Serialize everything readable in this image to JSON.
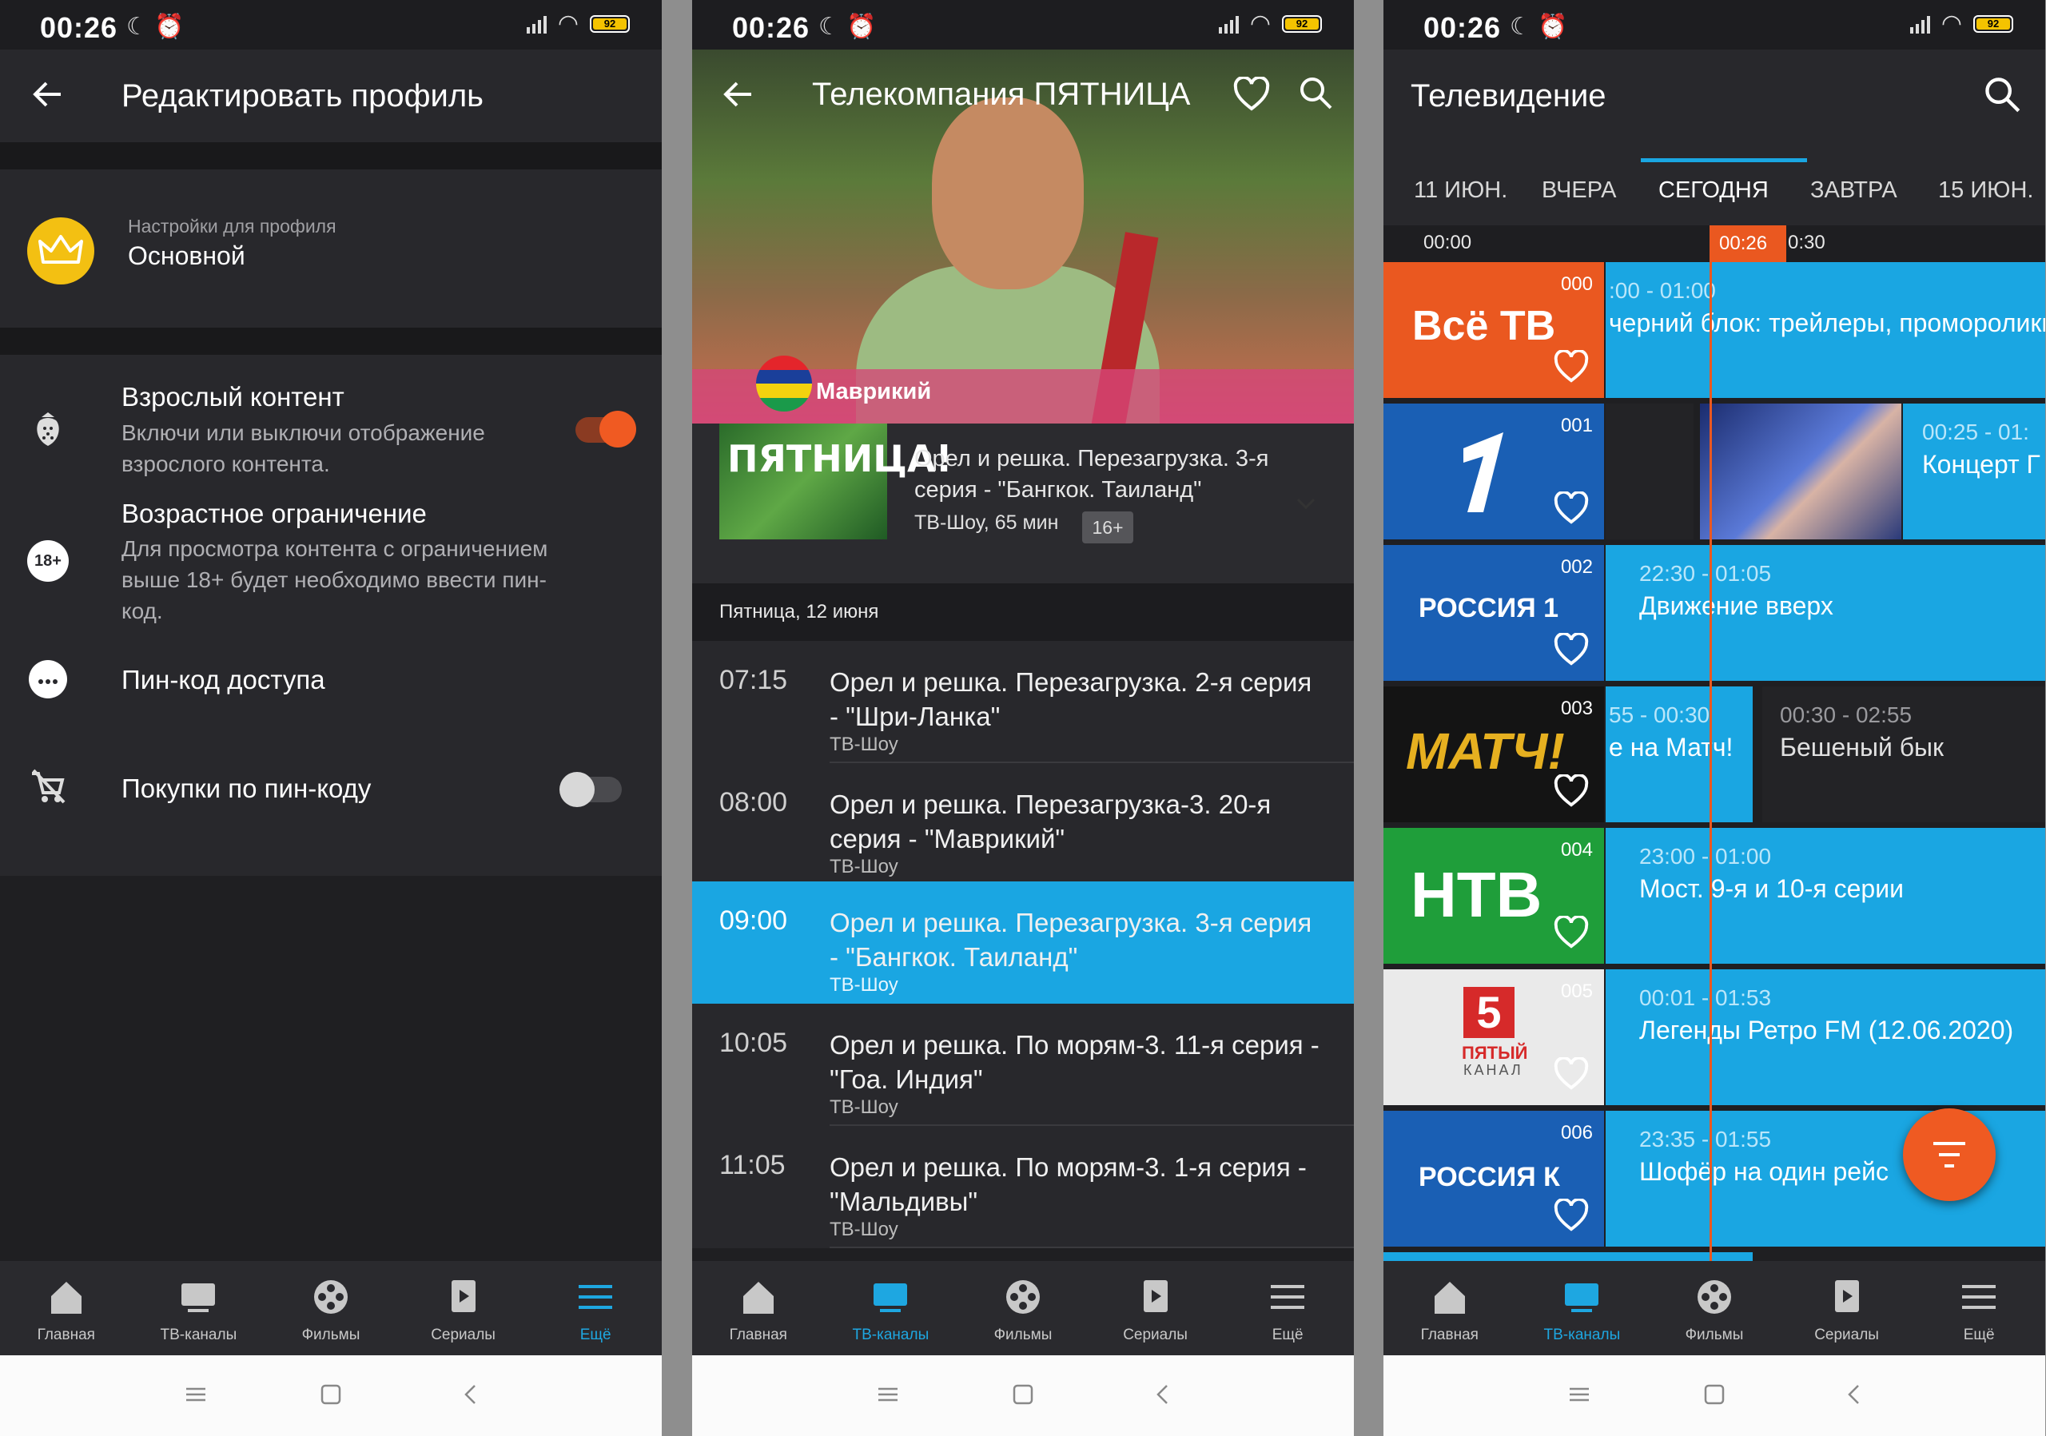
{
  "status": {
    "time": "00:26",
    "battery": "92"
  },
  "nav": {
    "items": [
      {
        "label": "Главная",
        "icon": "home-icon"
      },
      {
        "label": "ТВ-каналы",
        "icon": "tv-icon"
      },
      {
        "label": "Фильмы",
        "icon": "film-reel-icon"
      },
      {
        "label": "Сериалы",
        "icon": "series-icon"
      },
      {
        "label": "Ещё",
        "icon": "menu-icon"
      }
    ]
  },
  "profile_screen": {
    "title": "Редактировать профиль",
    "profile_subtitle": "Настройки для профиля",
    "profile_name": "Основной",
    "settings": [
      {
        "title": "Взрослый контент",
        "desc": "Включи или выключи отображение взрослого контента.",
        "toggle": true,
        "icon": "strawberry-icon"
      },
      {
        "title": "Возрастное ограничение",
        "desc": "Для просмотра контента с ограничением выше 18+ будет необходимо ввести пин-код.",
        "icon": "age-18-icon",
        "icon_text": "18+"
      },
      {
        "title": "Пин-код доступа",
        "icon": "pin-code-icon"
      },
      {
        "title": "Покупки по пин-коду",
        "toggle": false,
        "icon": "no-cart-icon"
      }
    ]
  },
  "channel_screen": {
    "title": "Телекомпания ПЯТНИЦА",
    "hero_caption": "Маврикий",
    "logo_text": "ПЯТНИЦА!",
    "now": {
      "title": "Орел и решка. Перезагрузка. 3-я серия - \"Бангкок. Таиланд\"",
      "meta": "ТВ-Шоу, 65 мин",
      "rating": "16+"
    },
    "date_header": "Пятница, 12 июня",
    "schedule": [
      {
        "time": "07:15",
        "title": "Орел и решка. Перезагрузка. 2-я серия - \"Шри-Ланка\"",
        "genre": "ТВ-Шоу",
        "active": false
      },
      {
        "time": "08:00",
        "title": "Орел и решка. Перезагрузка-3. 20-я серия - \"Маврикий\"",
        "genre": "ТВ-Шоу",
        "active": false
      },
      {
        "time": "09:00",
        "title": "Орел и решка. Перезагрузка. 3-я серия - \"Бангкок. Таиланд\"",
        "genre": "ТВ-Шоу",
        "active": true
      },
      {
        "time": "10:05",
        "title": "Орел и решка. По морям-3. 11-я серия - \"Гоа. Индия\"",
        "genre": "ТВ-Шоу",
        "active": false
      },
      {
        "time": "11:05",
        "title": "Орел и решка. По морям-3. 1-я серия - \"Мальдивы\"",
        "genre": "ТВ-Шоу",
        "active": false
      }
    ]
  },
  "tv_screen": {
    "title": "Телевидение",
    "days": [
      "11 ИЮН.",
      "ВЧЕРА",
      "СЕГОДНЯ",
      "ЗАВТРА",
      "15 ИЮН."
    ],
    "active_day": "СЕГОДНЯ",
    "timeline": {
      "start": "00:00",
      "now": "00:26",
      "next": "0:30"
    },
    "channels": [
      {
        "num": "000",
        "logo": "Всё ТВ",
        "programs": [
          {
            "time": ":00 - 01:00",
            "name": "черний блок: трейлеры, проморолики"
          }
        ]
      },
      {
        "num": "001",
        "logo": "Первый канал",
        "programs": [
          {
            "time": "00:25 - 01:",
            "name": "Концерт Г"
          }
        ]
      },
      {
        "num": "002",
        "logo": "РОССИЯ 1",
        "programs": [
          {
            "time": "22:30 - 01:05",
            "name": "Движение вверх"
          }
        ]
      },
      {
        "num": "003",
        "logo": "МАТЧ!",
        "programs": [
          {
            "time": "55 - 00:30",
            "name": "е на Матч!"
          },
          {
            "time": "00:30 - 02:55",
            "name": "Бешеный бык"
          }
        ]
      },
      {
        "num": "004",
        "logo": "НТВ",
        "programs": [
          {
            "time": "23:00 - 01:00",
            "name": "Мост. 9-я и 10-я серии"
          }
        ]
      },
      {
        "num": "005",
        "logo": "ПЯТЫЙ КАНАЛ",
        "logo_text": {
          "big": "5",
          "line1": "ПЯТЫЙ",
          "line2": "КАНАЛ"
        },
        "programs": [
          {
            "time": "00:01 - 01:53",
            "name": "Легенды Ретро FM (12.06.2020)"
          }
        ]
      },
      {
        "num": "006",
        "logo": "РОССИЯ К",
        "programs": [
          {
            "time": "23:35 - 01:55",
            "name": "Шофёр на один рейс"
          }
        ]
      }
    ]
  },
  "colors": {
    "accent": "#1aa6e2",
    "orange": "#ea5820",
    "bg": "#1f1f22",
    "card": "#28282c"
  }
}
